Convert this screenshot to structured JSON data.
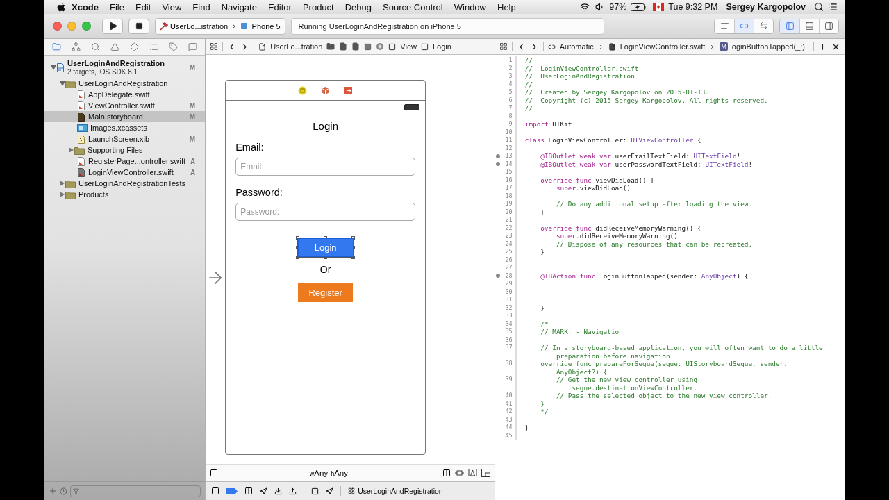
{
  "menu_bar": {
    "app": "Xcode",
    "items": [
      "File",
      "Edit",
      "View",
      "Find",
      "Navigate",
      "Editor",
      "Product",
      "Debug",
      "Source Control",
      "Window",
      "Help"
    ],
    "battery": "97%",
    "clock": "Tue 9:32 PM",
    "user": "Sergey Kargopolov"
  },
  "toolbar": {
    "scheme": "UserLo...istration",
    "device": "iPhone 5",
    "status": "Running UserLoginAndRegistration on iPhone 5",
    "editor_modes": [
      {
        "kind": "standard",
        "selected": false
      },
      {
        "kind": "assistant",
        "selected": true
      },
      {
        "kind": "version",
        "selected": false
      }
    ],
    "panels": [
      {
        "kind": "navigator",
        "selected": true
      },
      {
        "kind": "debug",
        "selected": false
      },
      {
        "kind": "utilities",
        "selected": false
      }
    ]
  },
  "navigator": {
    "tabs": [
      {
        "kind": "project",
        "selected": true
      },
      {
        "kind": "symbol",
        "selected": false
      },
      {
        "kind": "find",
        "selected": false
      },
      {
        "kind": "issue",
        "selected": false
      },
      {
        "kind": "test",
        "selected": false
      },
      {
        "kind": "debug",
        "selected": false
      },
      {
        "kind": "breakpoint",
        "selected": false
      },
      {
        "kind": "report",
        "selected": false
      }
    ],
    "tree": [
      {
        "kind": "project",
        "name": "UserLoginAndRegistration",
        "subtitle": "2 targets, iOS SDK 8.1",
        "badge": "M",
        "expanded": true,
        "selected": false,
        "children": [
          {
            "kind": "group",
            "name": "UserLoginAndRegistration",
            "expanded": true,
            "selected": false,
            "children": [
              {
                "kind": "swift",
                "name": "AppDelegate.swift",
                "selected": false
              },
              {
                "kind": "swift",
                "name": "ViewController.swift",
                "badge": "M",
                "selected": false
              },
              {
                "kind": "storyboard",
                "name": "Main.storyboard",
                "badge": "M",
                "selected": true
              },
              {
                "kind": "assets",
                "name": "Images.xcassets",
                "selected": false
              },
              {
                "kind": "xib",
                "name": "LaunchScreen.xib",
                "badge": "M",
                "selected": false
              },
              {
                "kind": "group",
                "name": "Supporting Files",
                "expanded": false,
                "selected": false
              },
              {
                "kind": "swift",
                "name": "RegisterPage...ontroller.swift",
                "badge": "A",
                "selected": false
              },
              {
                "kind": "swift_dark",
                "name": "LoginViewController.swift",
                "badge": "A",
                "selected": false
              }
            ]
          },
          {
            "kind": "group",
            "name": "UserLoginAndRegistrationTests",
            "expanded": false,
            "selected": false
          },
          {
            "kind": "group",
            "name": "Products",
            "expanded": false,
            "selected": false
          }
        ]
      }
    ]
  },
  "storyboard": {
    "jump_bar": {
      "project": "UserLo...tration",
      "view": "View",
      "button": "Login"
    },
    "scene": {
      "title": "Login",
      "email_label": "Email:",
      "email_field": {
        "placeholder": "Email:"
      },
      "password_label": "Password:",
      "password_field": {
        "placeholder": "Password:"
      },
      "login_button": {
        "label": "Login",
        "selected": true
      },
      "or_text": "Or",
      "register_button": {
        "label": "Register",
        "selected": false
      }
    },
    "size_class": [
      {
        "prefix": "w",
        "value": "Any"
      },
      {
        "prefix": "h",
        "value": "Any"
      }
    ],
    "debug_target": "UserLoginAndRegistration"
  },
  "code_editor": {
    "jump_bar": {
      "mode": "Automatic",
      "file": "LoginViewController.swift",
      "method_badge": "M",
      "method": "loginButtonTapped(_:)"
    },
    "lines": [
      {
        "number": "1",
        "connected": false,
        "segments": [
          {
            "kind": "comment",
            "text": "//"
          }
        ]
      },
      {
        "number": "2",
        "connected": false,
        "segments": [
          {
            "kind": "comment",
            "text": "//  LoginViewController.swift"
          }
        ]
      },
      {
        "number": "3",
        "connected": false,
        "segments": [
          {
            "kind": "comment",
            "text": "//  UserLoginAndRegistration"
          }
        ]
      },
      {
        "number": "4",
        "connected": false,
        "segments": [
          {
            "kind": "comment",
            "text": "//"
          }
        ]
      },
      {
        "number": "5",
        "connected": false,
        "segments": [
          {
            "kind": "comment",
            "text": "//  Created by Sergey Kargopolov on 2015-01-13."
          }
        ]
      },
      {
        "number": "6",
        "connected": false,
        "segments": [
          {
            "kind": "comment",
            "text": "//  Copyright (c) 2015 Sergey Kargopolov. All rights reserved."
          }
        ]
      },
      {
        "number": "7",
        "connected": false,
        "segments": [
          {
            "kind": "comment",
            "text": "//"
          }
        ]
      },
      {
        "number": "8",
        "connected": false
      },
      {
        "number": "9",
        "connected": false,
        "segments": [
          {
            "kind": "keyword",
            "text": "import"
          },
          {
            "kind": "plain",
            "text": " UIKit"
          }
        ]
      },
      {
        "number": "10",
        "connected": false
      },
      {
        "number": "11",
        "connected": false,
        "segments": [
          {
            "kind": "keyword",
            "text": "class"
          },
          {
            "kind": "plain",
            "text": " LoginViewController: "
          },
          {
            "kind": "type",
            "text": "UIViewController"
          },
          {
            "kind": "plain",
            "text": " {"
          }
        ]
      },
      {
        "number": "12",
        "connected": false
      },
      {
        "number": "13",
        "connected": true,
        "segments": [
          {
            "kind": "keyword",
            "text": "    @IBOutlet weak var"
          },
          {
            "kind": "plain",
            "text": " userEmailTextField: "
          },
          {
            "kind": "type",
            "text": "UITextField"
          },
          {
            "kind": "plain",
            "text": "!"
          }
        ]
      },
      {
        "number": "14",
        "connected": true,
        "segments": [
          {
            "kind": "keyword",
            "text": "    @IBOutlet weak var"
          },
          {
            "kind": "plain",
            "text": " userPasswordTextField: "
          },
          {
            "kind": "type",
            "text": "UITextField"
          },
          {
            "kind": "plain",
            "text": "!"
          }
        ]
      },
      {
        "number": "15",
        "connected": false
      },
      {
        "number": "16",
        "connected": false,
        "segments": [
          {
            "kind": "keyword",
            "text": "    override func"
          },
          {
            "kind": "plain",
            "text": " viewDidLoad() {"
          }
        ]
      },
      {
        "number": "17",
        "connected": false,
        "segments": [
          {
            "kind": "keyword",
            "text": "        super"
          },
          {
            "kind": "plain",
            "text": ".viewDidLoad()"
          }
        ]
      },
      {
        "number": "18",
        "connected": false
      },
      {
        "number": "19",
        "connected": false,
        "segments": [
          {
            "kind": "comment",
            "text": "        // Do any additional setup after loading the view."
          }
        ]
      },
      {
        "number": "20",
        "connected": false,
        "segments": [
          {
            "kind": "plain",
            "text": "    }"
          }
        ]
      },
      {
        "number": "21",
        "connected": false
      },
      {
        "number": "22",
        "connected": false,
        "segments": [
          {
            "kind": "keyword",
            "text": "    override func"
          },
          {
            "kind": "plain",
            "text": " didReceiveMemoryWarning() {"
          }
        ]
      },
      {
        "number": "23",
        "connected": false,
        "segments": [
          {
            "kind": "keyword",
            "text": "        super"
          },
          {
            "kind": "plain",
            "text": ".didReceiveMemoryWarning()"
          }
        ]
      },
      {
        "number": "24",
        "connected": false,
        "segments": [
          {
            "kind": "comment",
            "text": "        // Dispose of any resources that can be recreated."
          }
        ]
      },
      {
        "number": "25",
        "connected": false,
        "segments": [
          {
            "kind": "plain",
            "text": "    }"
          }
        ]
      },
      {
        "number": "26",
        "connected": false
      },
      {
        "number": "27",
        "connected": false
      },
      {
        "number": "28",
        "connected": true,
        "segments": [
          {
            "kind": "keyword",
            "text": "    @IBAction func"
          },
          {
            "kind": "plain",
            "text": " loginButtonTapped(sender: "
          },
          {
            "kind": "type",
            "text": "AnyObject"
          },
          {
            "kind": "plain",
            "text": ") {"
          }
        ]
      },
      {
        "number": "29",
        "connected": false
      },
      {
        "number": "30",
        "connected": false
      },
      {
        "number": "31",
        "connected": false
      },
      {
        "number": "32",
        "connected": false,
        "segments": [
          {
            "kind": "plain",
            "text": "    }"
          }
        ]
      },
      {
        "number": "33",
        "connected": false
      },
      {
        "number": "34",
        "connected": false,
        "segments": [
          {
            "kind": "comment",
            "text": "    /*"
          }
        ]
      },
      {
        "number": "35",
        "connected": false,
        "segments": [
          {
            "kind": "comment",
            "text": "    // MARK: - Navigation"
          }
        ]
      },
      {
        "number": "36",
        "connected": false
      },
      {
        "number": "37",
        "connected": false,
        "segments": [
          {
            "kind": "comment",
            "text": "    // In a storyboard-based application, you will often want to do a little"
          }
        ],
        "wrap": [
          {
            "kind": "comment",
            "text": "        preparation before navigation"
          }
        ]
      },
      {
        "number": "38",
        "connected": false,
        "segments": [
          {
            "kind": "comment",
            "text": "    override func prepareForSegue(segue: UIStoryboardSegue, sender:"
          }
        ],
        "wrap": [
          {
            "kind": "comment",
            "text": "        AnyObject?) {"
          }
        ]
      },
      {
        "number": "39",
        "connected": false,
        "segments": [
          {
            "kind": "comment",
            "text": "        // Get the new view controller using"
          }
        ],
        "wrap": [
          {
            "kind": "comment",
            "text": "            segue.destinationViewController."
          }
        ]
      },
      {
        "number": "40",
        "connected": false,
        "segments": [
          {
            "kind": "comment",
            "text": "        // Pass the selected object to the new view controller."
          }
        ]
      },
      {
        "number": "41",
        "connected": false,
        "segments": [
          {
            "kind": "comment",
            "text": "    }"
          }
        ]
      },
      {
        "number": "42",
        "connected": false,
        "segments": [
          {
            "kind": "comment",
            "text": "    */"
          }
        ]
      },
      {
        "number": "43",
        "connected": false
      },
      {
        "number": "44",
        "connected": false,
        "segments": [
          {
            "kind": "plain",
            "text": "}"
          }
        ]
      },
      {
        "number": "45",
        "connected": false
      }
    ]
  }
}
